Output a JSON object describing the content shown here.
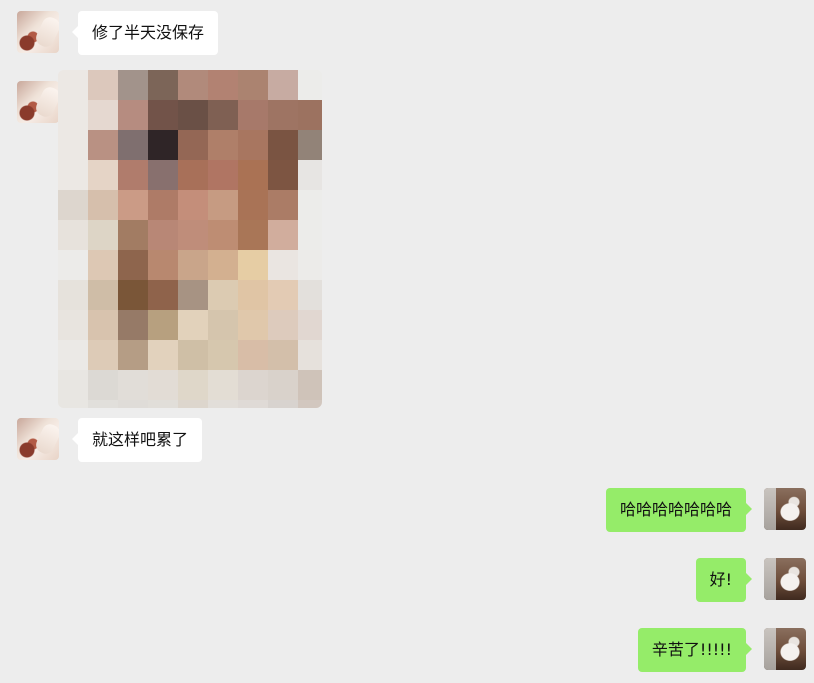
{
  "messages": [
    {
      "side": "left",
      "type": "text",
      "text": "修了半天没保存"
    },
    {
      "side": "left",
      "type": "image",
      "description_hidden": true
    },
    {
      "side": "left",
      "type": "text",
      "text": "就这样吧累了"
    },
    {
      "side": "right",
      "type": "text",
      "text": "哈哈哈哈哈哈哈"
    },
    {
      "side": "right",
      "type": "text",
      "text": "好!"
    },
    {
      "side": "right",
      "type": "text",
      "text": "辛苦了!!!!!"
    }
  ],
  "colors": {
    "background": "#ededed",
    "bubble_left": "#ffffff",
    "bubble_right": "#95ec69"
  },
  "image_mosaic": [
    [
      "#ece8e4",
      "#dcc8bc",
      "#a2938b",
      "#7c6558",
      "#b18a7b",
      "#b28272",
      "#ab8370",
      "#c7aba2",
      "#ececea"
    ],
    [
      "#ece8e4",
      "#e5d8d0",
      "#b68c80",
      "#725349",
      "#6a5046",
      "#7f6053",
      "#a7796a",
      "#9e7463",
      "#9c7260"
    ],
    [
      "#ece8e4",
      "#b99183",
      "#7f6f6f",
      "#2f2527",
      "#946755",
      "#af7f69",
      "#a87660",
      "#7a5442",
      "#928378"
    ],
    [
      "#ece8e4",
      "#e5d4c6",
      "#b07c6c",
      "#88706e",
      "#a87059",
      "#b07563",
      "#aa7254",
      "#7d5542",
      "#e7e5e3"
    ],
    [
      "#ddd6ce",
      "#d6bfac",
      "#cb9b86",
      "#ae7b67",
      "#c48e7a",
      "#c69b82",
      "#a97356",
      "#ab7c66",
      "#ececea"
    ],
    [
      "#e7e2dc",
      "#ddd5c6",
      "#a27c63",
      "#b88776",
      "#bf8d7a",
      "#be8d73",
      "#a97657",
      "#d1ad9d",
      "#ececea"
    ],
    [
      "#ecebe9",
      "#ddc8b4",
      "#8e654d",
      "#b8886f",
      "#c9a58a",
      "#d3b090",
      "#e6cda4",
      "#eae5e1",
      "#ecebe9"
    ],
    [
      "#e6e2dc",
      "#cfbda7",
      "#7a5638",
      "#8f634b",
      "#a79383",
      "#dccbb2",
      "#e0c5a5",
      "#e3cbb4",
      "#e3e0dc"
    ],
    [
      "#e8e4df",
      "#d8c3ae",
      "#967a67",
      "#b7a07f",
      "#e2d2bb",
      "#d5c5ad",
      "#e0c8ab",
      "#ddcbbd",
      "#e1d7d1"
    ],
    [
      "#ebe9e6",
      "#ddcbb7",
      "#b59d85",
      "#e2d2bd",
      "#cfbfa6",
      "#d6c7ae",
      "#d8bda7",
      "#d3bfaa",
      "#e6e1dc"
    ],
    [
      "#e8e6e2",
      "#dcd9d4",
      "#e1ddd8",
      "#e2dcd5",
      "#dfd7c9",
      "#e3ddd4",
      "#dcd5cf",
      "#d9d2cb",
      "#cfc3b9"
    ],
    [
      "#e8e6e2",
      "#e1dfdb",
      "#dfdcd8",
      "#e1ded9",
      "#ddd6cd",
      "#e2ded9",
      "#dfdad6",
      "#d8d3cf",
      "#d2c7bf"
    ]
  ]
}
